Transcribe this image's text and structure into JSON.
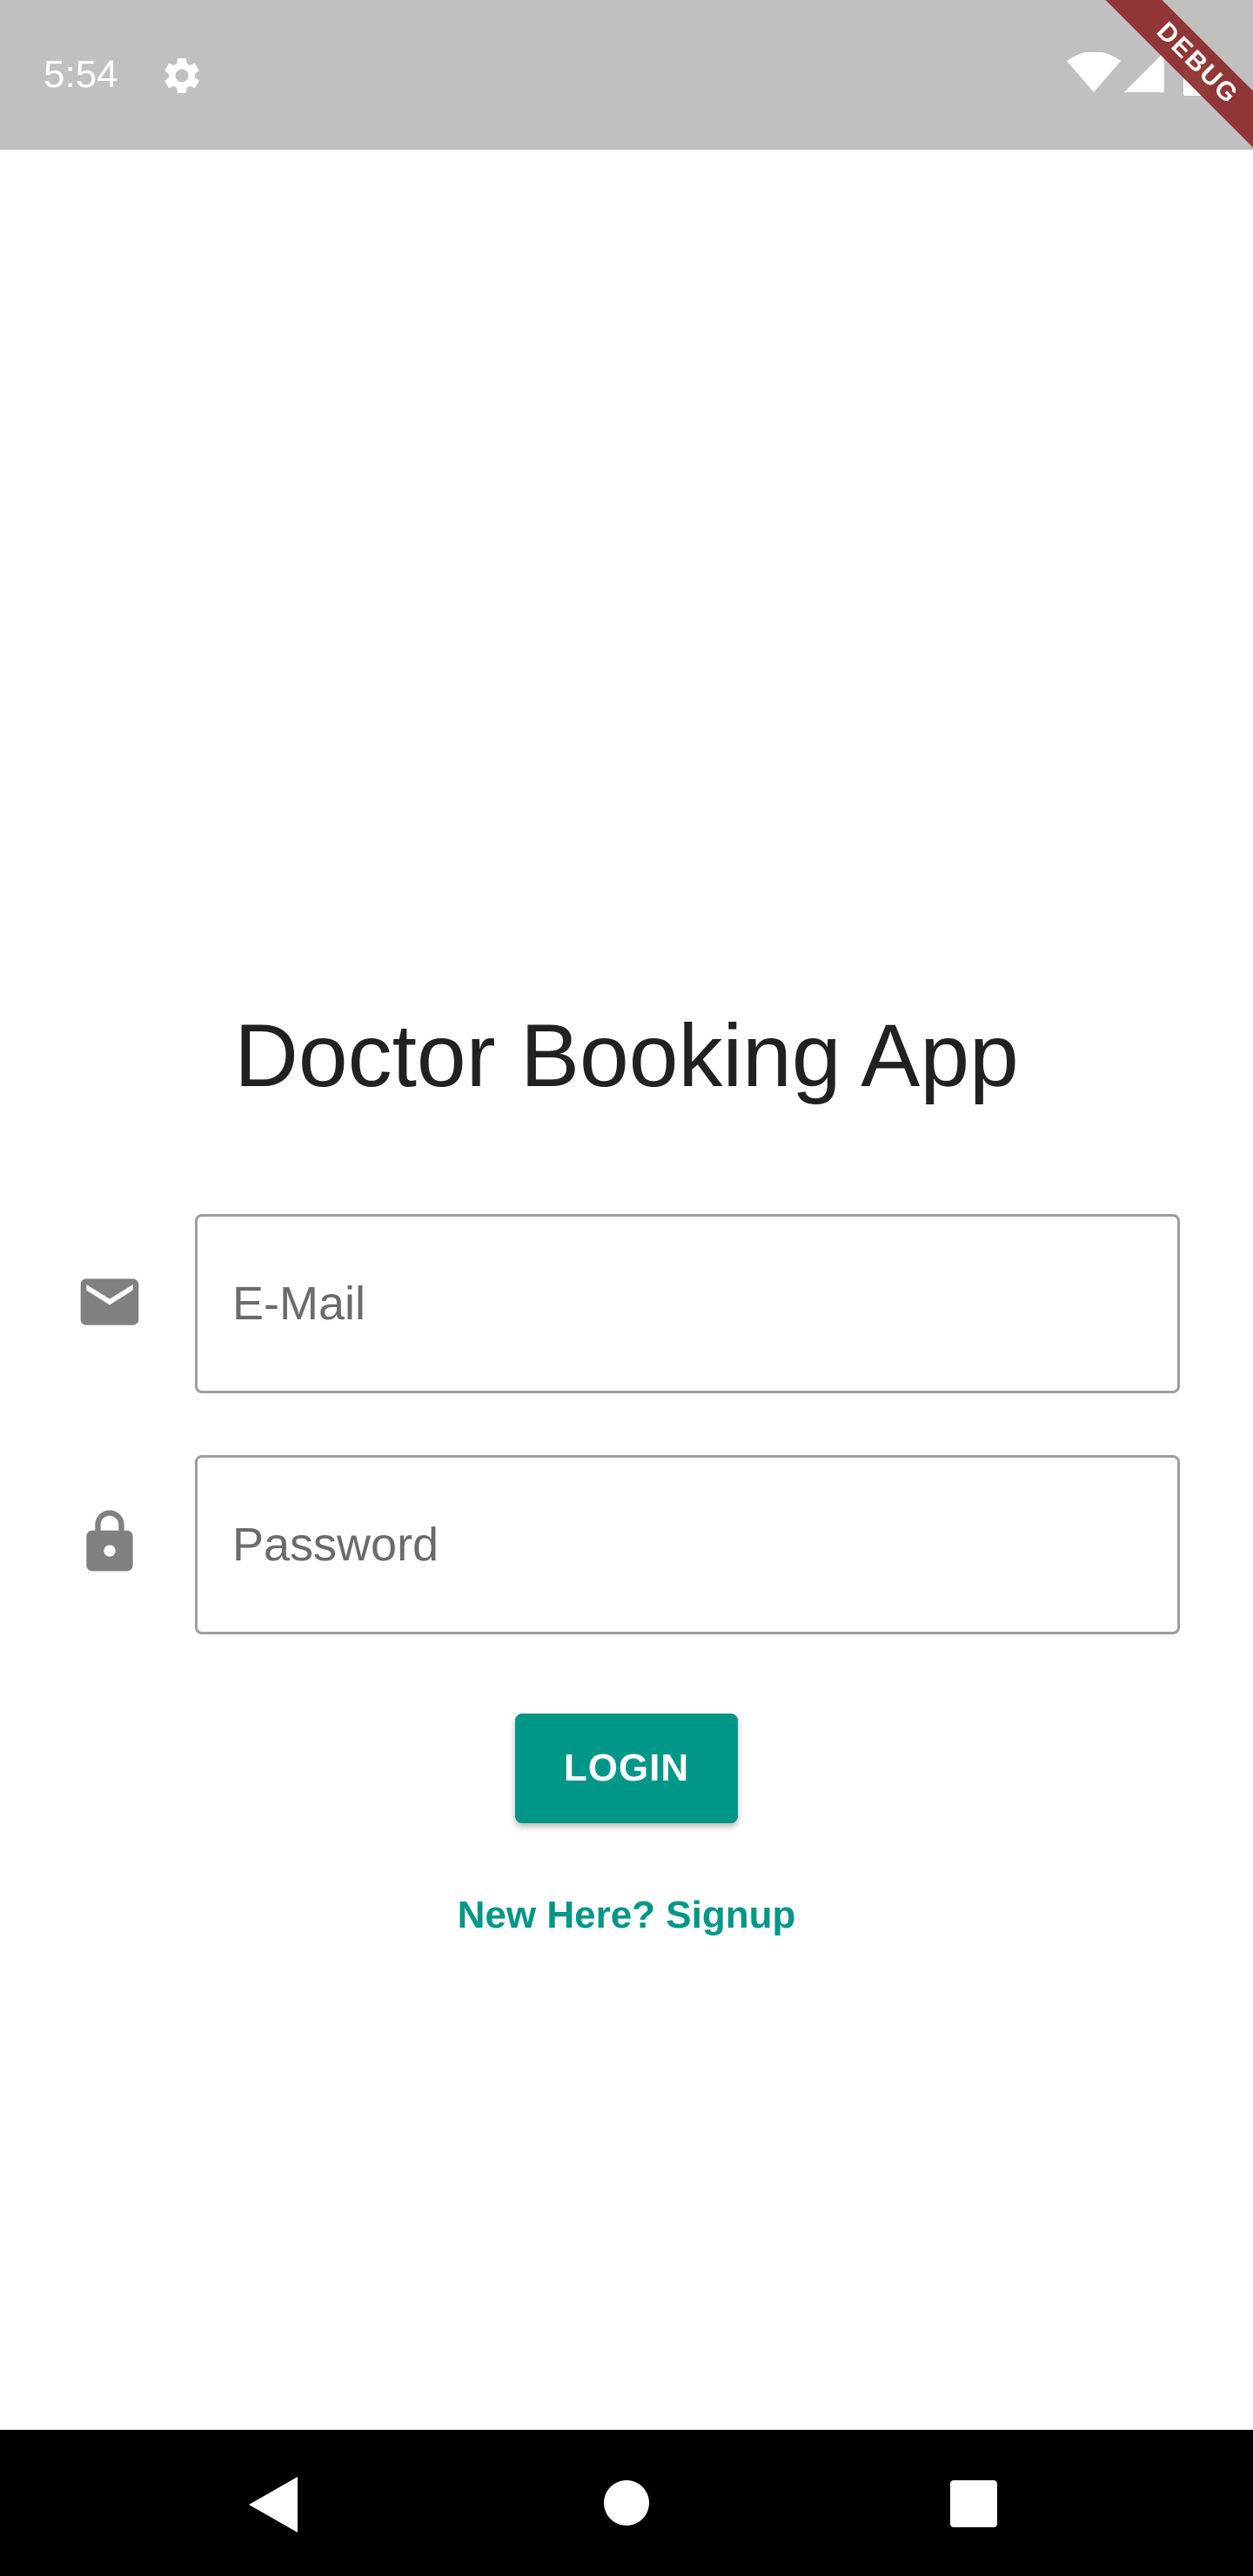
{
  "status_bar": {
    "time": "5:54",
    "settings_icon": "gear-icon",
    "wifi_icon": "wifi-icon",
    "signal_icon": "cell-signal-icon",
    "battery_icon": "battery-icon",
    "background_color": "#c0c0c0"
  },
  "debug_banner": {
    "label": "DEBUG",
    "color": "#8c2b2b"
  },
  "login": {
    "title": "Doctor Booking App",
    "email": {
      "placeholder": "E-Mail",
      "value": "",
      "icon": "email-icon"
    },
    "password": {
      "placeholder": "Password",
      "value": "",
      "icon": "lock-icon"
    },
    "login_label": "LOGIN",
    "signup_label": "New Here? Signup",
    "accent_color": "#009688"
  },
  "nav_bar": {
    "back_icon": "back-triangle-icon",
    "home_icon": "home-circle-icon",
    "recents_icon": "recents-square-icon"
  }
}
